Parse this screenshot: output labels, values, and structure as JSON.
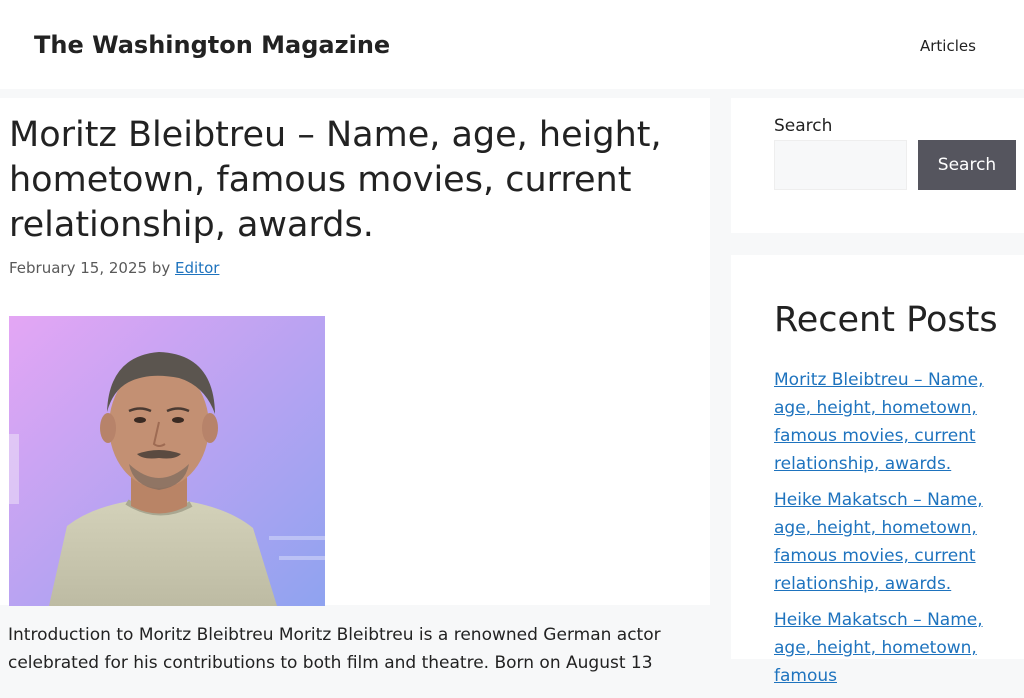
{
  "header": {
    "site_title": "The Washington Magazine",
    "nav": {
      "articles": "Articles"
    }
  },
  "article": {
    "title": "Moritz Bleibtreu – Name, age, height, hometown, famous movies, current relationship, awards.",
    "date": "February 15, 2025",
    "by": "by",
    "author": "Editor",
    "intro": "Introduction to Moritz Bleibtreu Moritz Bleibtreu is a renowned German actor celebrated for his contributions to both film and theatre. Born on August 13"
  },
  "sidebar": {
    "search": {
      "label": "Search",
      "placeholder": "",
      "value": "",
      "button": "Search"
    },
    "recent_posts": {
      "heading": "Recent Posts",
      "items": [
        "Moritz Bleibtreu – Name, age, height, hometown, famous movies, current relationship, awards.",
        "Heike Makatsch – Name, age, height, hometown, famous movies, current relationship, awards.",
        "Heike Makatsch – Name, age, height, hometown, famous"
      ]
    }
  },
  "colors": {
    "link": "#1e73be",
    "button_bg": "#55555e",
    "page_bg": "#f7f8f9"
  }
}
